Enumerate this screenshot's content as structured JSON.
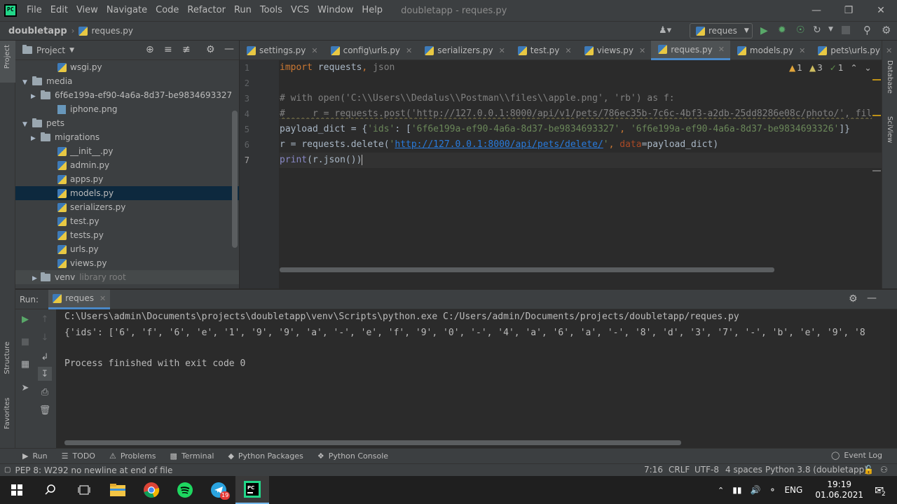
{
  "menu": {
    "items": [
      "File",
      "Edit",
      "View",
      "Navigate",
      "Code",
      "Refactor",
      "Run",
      "Tools",
      "VCS",
      "Window",
      "Help"
    ],
    "window_title": "doubletapp - reques.py"
  },
  "navbar": {
    "project": "doubletapp",
    "file": "reques.py",
    "run_config": "reques"
  },
  "project_panel": {
    "title": "Project",
    "tree": [
      {
        "label": "wsgi.py",
        "type": "py",
        "indent": 5,
        "arrow": ""
      },
      {
        "label": "media",
        "type": "folder",
        "indent": 2,
        "arrow": "open"
      },
      {
        "label": "6f6e199a-ef90-4a6a-8d37-be9834693327",
        "type": "folder",
        "indent": 3,
        "arrow": "closed"
      },
      {
        "label": "iphone.png",
        "type": "img",
        "indent": 5,
        "arrow": ""
      },
      {
        "label": "pets",
        "type": "folder",
        "indent": 2,
        "arrow": "open"
      },
      {
        "label": "migrations",
        "type": "folder",
        "indent": 3,
        "arrow": "closed"
      },
      {
        "label": "__init__.py",
        "type": "py",
        "indent": 5,
        "arrow": ""
      },
      {
        "label": "admin.py",
        "type": "py",
        "indent": 5,
        "arrow": ""
      },
      {
        "label": "apps.py",
        "type": "py",
        "indent": 5,
        "arrow": ""
      },
      {
        "label": "models.py",
        "type": "py",
        "indent": 5,
        "arrow": "",
        "selected": true
      },
      {
        "label": "serializers.py",
        "type": "py",
        "indent": 5,
        "arrow": ""
      },
      {
        "label": "test.py",
        "type": "py",
        "indent": 5,
        "arrow": ""
      },
      {
        "label": "tests.py",
        "type": "py",
        "indent": 5,
        "arrow": ""
      },
      {
        "label": "urls.py",
        "type": "py",
        "indent": 5,
        "arrow": ""
      },
      {
        "label": "views.py",
        "type": "py",
        "indent": 5,
        "arrow": ""
      }
    ],
    "venv_label": "venv",
    "venv_hint": "library root"
  },
  "tabs": [
    "settings.py",
    "config\\urls.py",
    "serializers.py",
    "test.py",
    "views.py",
    "reques.py",
    "models.py",
    "pets\\urls.py"
  ],
  "active_tab": "reques.py",
  "editor": {
    "line_numbers": [
      "1",
      "2",
      "3",
      "4",
      "5",
      "6",
      "7"
    ],
    "inspections": {
      "warnings": "1",
      "weak": "3",
      "ok": "1"
    },
    "line1": {
      "kw": "import",
      "rest": " requests",
      "comma": ",",
      "mod": " json"
    },
    "line3": "# with open('C:\\\\Users\\\\Dedalus\\\\Postman\\\\files\\\\apple.png', 'rb') as f:",
    "line4": "#     r = requests.post('http://127.0.0.1:8000/api/v1/pets/786ec35b-7c6c-4bf3-a2db-25dd8286e08c/photo/', fil",
    "line5": {
      "lhs": "payload_dict = {",
      "k": "'ids'",
      "mid": ": [",
      "v1": "'6f6e199a-ef90-4a6a-8d37-be9834693327'",
      "sep": ", ",
      "v2": "'6f6e199a-ef90-4a6a-8d37-be9834693326'",
      "end": "]}"
    },
    "line6": {
      "a": "r = requests.delete(",
      "q1": "'",
      "url": "http://127.0.0.1:8000/api/pets/delete/",
      "q2": "'",
      "b": ", ",
      "p": "data",
      "c": "=payload_dict)"
    },
    "line7": {
      "a": "print",
      "b": "(r.json())"
    }
  },
  "run": {
    "label": "Run:",
    "config": "reques",
    "cmd": "C:\\Users\\admin\\Documents\\projects\\doubletapp\\venv\\Scripts\\python.exe C:/Users/admin/Documents/projects/doubletapp/reques.py",
    "output": "{'ids': ['6', 'f', '6', 'e', '1', '9', '9', 'a', '-', 'e', 'f', '9', '0', '-', '4', 'a', '6', 'a', '-', '8', 'd', '3', '7', '-', 'b', 'e', '9', '8",
    "finished": "Process finished with exit code 0"
  },
  "bottom_tabs": [
    "Run",
    "TODO",
    "Problems",
    "Terminal",
    "Python Packages",
    "Python Console"
  ],
  "event_log": "Event Log",
  "left_tool": {
    "project": "Project",
    "structure": "Structure",
    "favorites": "Favorites"
  },
  "right_tool": {
    "database": "Database",
    "sciview": "SciView"
  },
  "status": {
    "message": "PEP 8: W292 no newline at end of file",
    "pos": "7:16",
    "crlf": "CRLF",
    "enc": "UTF-8",
    "indent": "4 spaces",
    "interp": "Python 3.8 (doubletapp)"
  },
  "taskbar": {
    "lang": "ENG",
    "time": "19:19",
    "date": "01.06.2021",
    "telegram_badge": "19",
    "notif_count": "2"
  },
  "colors": {
    "accent": "#4a88c7",
    "bg": "#2b2b2b",
    "panel": "#3c3f41",
    "selection": "#0d293e"
  }
}
